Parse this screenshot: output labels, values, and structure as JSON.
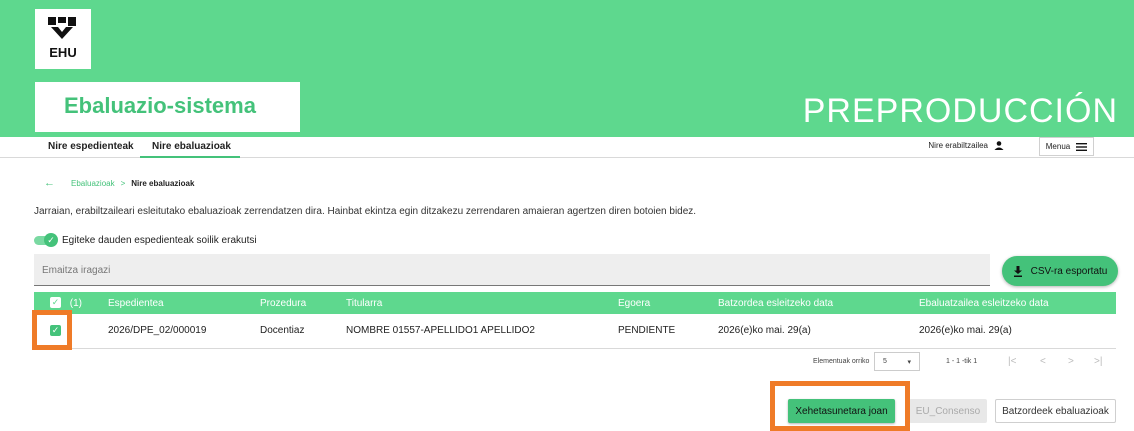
{
  "header": {
    "logo_text": "EHU",
    "app_title": "Ebaluazio-sistema",
    "environment": "PREPRODUCCIÓN"
  },
  "nav": {
    "tabs": [
      {
        "label": "Nire espedienteak"
      },
      {
        "label": "Nire ebaluazioak"
      }
    ],
    "user_label": "Nire erabiltzailea",
    "menu_label": "Menua"
  },
  "breadcrumb": {
    "link": "Ebaluazioak",
    "separator": ">",
    "current": "Nire ebaluazioak"
  },
  "description": "Jarraian, erabiltzaileari esleitutako ebaluazioak zerrendatzen dira. Hainbat ekintza egin ditzakezu zerrendaren amaieran agertzen diren botoien bidez.",
  "toggle": {
    "label": "Egiteke dauden espedienteak soilik erakutsi",
    "on": true
  },
  "filter": {
    "placeholder": "Emaitza iragazi"
  },
  "export_button": "CSV-ra esportatu",
  "table": {
    "selected_count": "(1)",
    "columns": [
      "Espedientea",
      "Prozedura",
      "Titularra",
      "Egoera",
      "Batzordea esleitzeko data",
      "Ebaluatzailea esleitzeko data"
    ],
    "rows": [
      {
        "espedientea": "2026/DPE_02/000019",
        "prozedura": "Docentiaz",
        "titularra": "NOMBRE 01557-APELLIDO1 APELLIDO2",
        "egoera": "PENDIENTE",
        "batzordea_data": "2026(e)ko mai. 29(a)",
        "ebaluatzailea_data": "2026(e)ko mai. 29(a)",
        "selected": true
      }
    ]
  },
  "pager": {
    "label": "Elementuak orriko",
    "page_size": "5",
    "range": "1 - 1 -tik 1"
  },
  "actions": {
    "go": "Xehetasunetara joan",
    "eu": "EU_Consenso",
    "committee": "Batzordeek ebaluazioak"
  },
  "colors": {
    "header_green": "#5ed88e",
    "accent_green": "#44c27a",
    "highlight_orange": "#ef7b28"
  }
}
